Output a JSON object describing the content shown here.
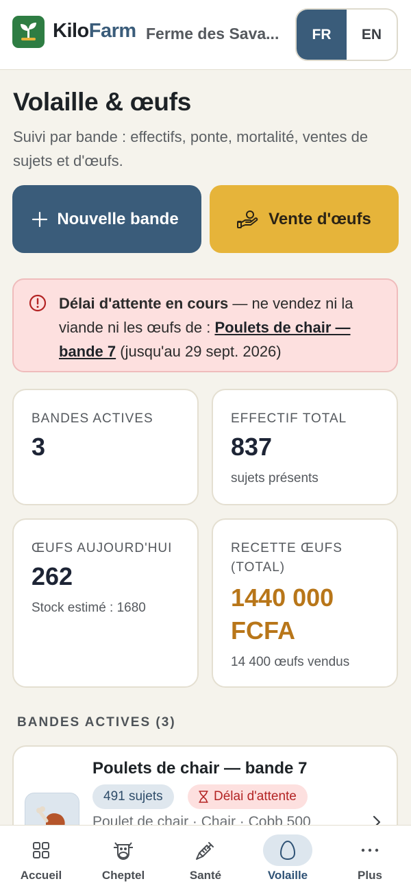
{
  "header": {
    "brand_part1": "Kilo",
    "brand_part2": "Farm",
    "farm_name": "Ferme des Sava...",
    "lang_fr": "FR",
    "lang_en": "EN",
    "active_lang": "FR"
  },
  "page": {
    "title": "Volaille & œufs",
    "subtitle": "Suivi par bande : effectifs, ponte, mortalité, ventes de sujets et d'œufs."
  },
  "actions": {
    "new_batch": "Nouvelle bande",
    "egg_sale": "Vente d'œufs"
  },
  "alert": {
    "strong": "Délai d'attente en cours",
    "text_1": " — ne vendez ni la viande ni les œufs de : ",
    "link": "Poulets de chair — bande 7",
    "text_2": " (jusqu'au 29 sept. 2026)"
  },
  "stats": {
    "active_batches": {
      "label": "BANDES ACTIVES",
      "value": "3"
    },
    "total_headcount": {
      "label": "EFFECTIF TOTAL",
      "value": "837",
      "sub": "sujets présents"
    },
    "eggs_today": {
      "label": "ŒUFS AUJOURD'HUI",
      "value": "262",
      "sub": "Stock estimé : 1680"
    },
    "egg_revenue": {
      "label": "RECETTE ŒUFS (TOTAL)",
      "value_line1": "1440 000",
      "value_line2": "FCFA",
      "sub": "14 400 œufs vendus"
    }
  },
  "section": {
    "active_batches_title": "BANDES ACTIVES (3)"
  },
  "batches": [
    {
      "title": "Poulets de chair — bande 7",
      "count_badge": "491 sujets",
      "delay_badge": "Délai d'attente",
      "meta": "Poulet de chair · Chair · Cobb 500"
    }
  ],
  "nav": {
    "items": [
      {
        "label": "Accueil",
        "icon": "grid-icon"
      },
      {
        "label": "Cheptel",
        "icon": "cow-icon"
      },
      {
        "label": "Santé",
        "icon": "syringe-icon"
      },
      {
        "label": "Volaille",
        "icon": "egg-icon"
      },
      {
        "label": "Plus",
        "icon": "more-icon"
      }
    ],
    "active": "Volaille"
  },
  "colors": {
    "primary": "#3a5c7a",
    "accent_yellow": "#e6b43a",
    "alert_bg": "#fde0df",
    "revenue": "#b87619",
    "brand_green": "#2e7d43"
  }
}
